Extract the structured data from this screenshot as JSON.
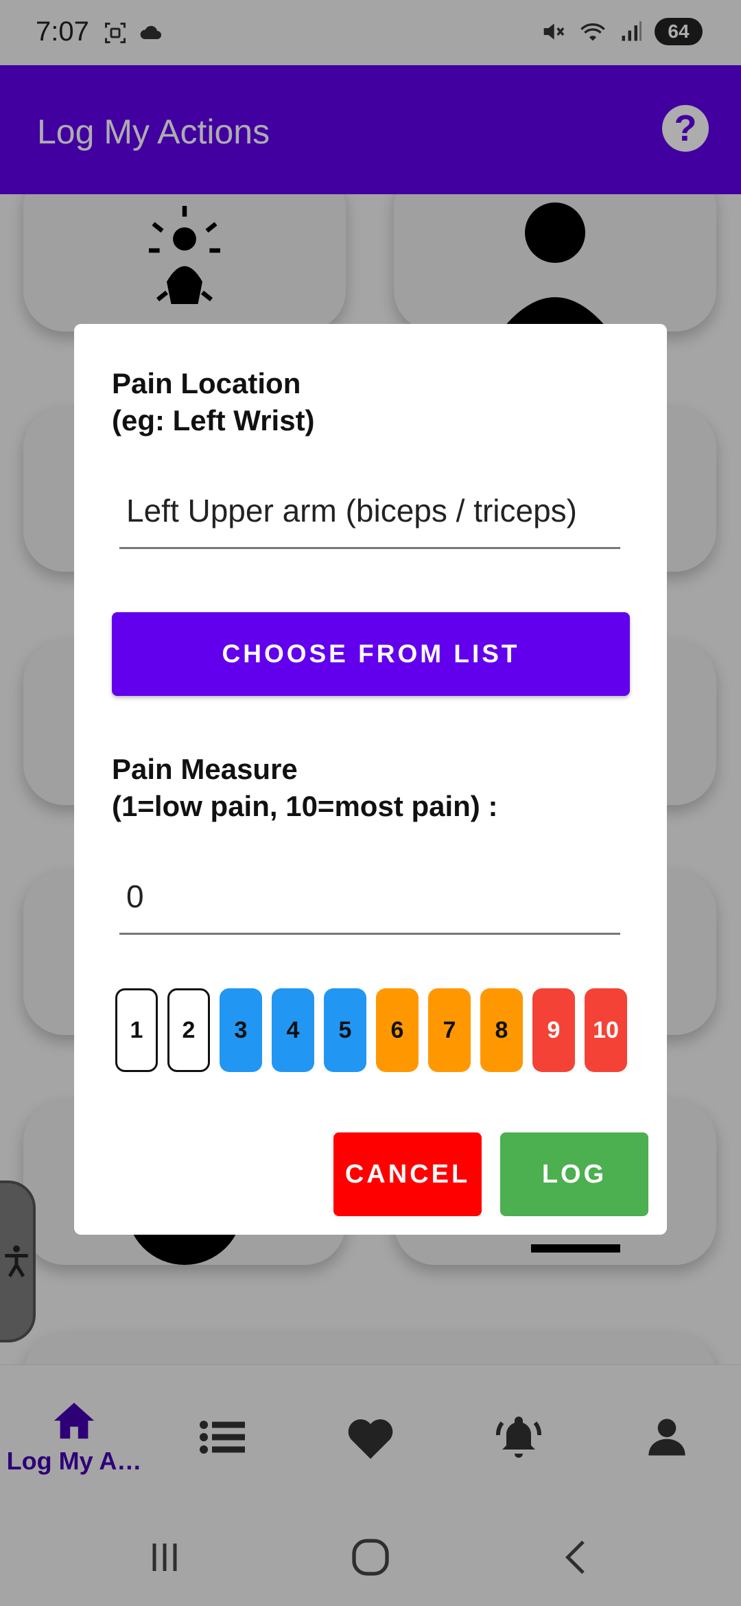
{
  "status_bar": {
    "time": "7:07",
    "battery": "64",
    "icons": [
      "screenshot-icon",
      "cloud-icon",
      "mute-icon",
      "wifi-icon",
      "signal-icon",
      "battery-icon"
    ]
  },
  "app_bar": {
    "title": "Log My Actions",
    "help_icon": "help-icon",
    "color": "#6200ee"
  },
  "dialog": {
    "pain_location_label": "Pain Location\n(eg: Left Wrist)",
    "pain_location_value": "Left Upper arm (biceps / triceps)",
    "choose_button": "CHOOSE FROM LIST",
    "pain_measure_label": "Pain Measure\n(1=low pain, 10=most pain) :",
    "pain_measure_value": "0",
    "scale": [
      {
        "label": "1",
        "color": "#ffffff"
      },
      {
        "label": "2",
        "color": "#ffffff"
      },
      {
        "label": "3",
        "color": "#2196f3"
      },
      {
        "label": "4",
        "color": "#2196f3"
      },
      {
        "label": "5",
        "color": "#2196f3"
      },
      {
        "label": "6",
        "color": "#ff9800"
      },
      {
        "label": "7",
        "color": "#ff9800"
      },
      {
        "label": "8",
        "color": "#ff9800"
      },
      {
        "label": "9",
        "color": "#f44336"
      },
      {
        "label": "10",
        "color": "#f44336"
      }
    ],
    "cancel_button": "CANCEL",
    "log_button": "LOG",
    "cancel_color": "#ff0000",
    "log_color": "#4caf50"
  },
  "bottom_nav": {
    "items": [
      {
        "icon": "home-icon",
        "label": "Log My A…",
        "active": true
      },
      {
        "icon": "list-icon",
        "label": ""
      },
      {
        "icon": "heart-icon",
        "label": ""
      },
      {
        "icon": "bell-icon",
        "label": ""
      },
      {
        "icon": "person-icon",
        "label": ""
      }
    ]
  },
  "system_nav": {
    "icons": [
      "recents-icon",
      "home-circle-icon",
      "back-icon"
    ]
  }
}
